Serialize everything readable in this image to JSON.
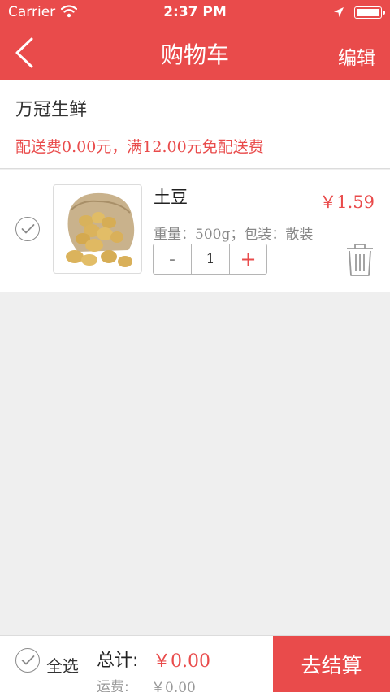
{
  "status_bar": {
    "carrier": "Carrier",
    "time": "2:37 PM"
  },
  "nav": {
    "title": "购物车",
    "edit_label": "编辑",
    "back_icon": "chevron-left-icon"
  },
  "store": {
    "name": "万冠生鲜",
    "delivery_note": "配送费0.00元，满12.00元免配送费"
  },
  "cart": {
    "items": [
      {
        "name": "土豆",
        "price": "￥1.59",
        "spec": "重量：500g；包装：散装",
        "quantity": "1",
        "minus_label": "-",
        "plus_label": "+"
      }
    ]
  },
  "footer": {
    "select_all_label": "全选",
    "total_label": "总计:",
    "total_value": "￥0.00",
    "shipping_label": "运费:",
    "shipping_value": "￥0.00",
    "checkout_label": "去结算"
  },
  "colors": {
    "accent": "#e94b4b",
    "background": "#efefef"
  }
}
